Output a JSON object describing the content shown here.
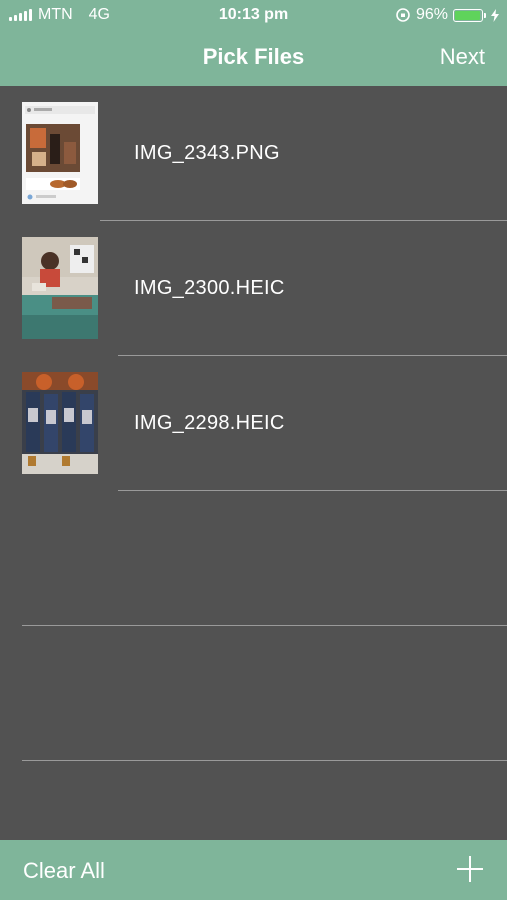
{
  "status": {
    "carrier": "MTN",
    "network": "4G",
    "time": "10:13 pm",
    "battery_percent": "96%",
    "battery_level": 0.96,
    "icons": [
      "signal-icon",
      "rotation-lock-icon",
      "battery-icon",
      "charging-icon"
    ]
  },
  "nav": {
    "title": "Pick Files",
    "next_label": "Next"
  },
  "files": [
    {
      "name": "IMG_2343.PNG"
    },
    {
      "name": "IMG_2300.HEIC"
    },
    {
      "name": "IMG_2298.HEIC"
    }
  ],
  "bottom": {
    "clear_label": "Clear All",
    "add_icon": "plus-icon"
  },
  "colors": {
    "accent": "#7fb59a",
    "background": "#525252",
    "separator": "#9a9a9a",
    "battery": "#5fd35b"
  }
}
